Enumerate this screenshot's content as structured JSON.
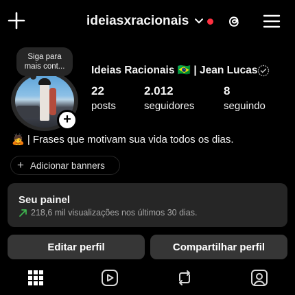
{
  "header": {
    "username": "ideiasxracionais",
    "create_icon": "plus-icon",
    "threads_icon": "threads-icon",
    "menu_icon": "menu-icon"
  },
  "note": {
    "text_line1": "Siga para",
    "text_line2": "mais cont..."
  },
  "profile": {
    "display_name": "Ideias Racionais 🇧🇷 | Jean Lucas",
    "stats": [
      {
        "value": "22",
        "label": "posts"
      },
      {
        "value": "2.012",
        "label": "seguidores"
      },
      {
        "value": "8",
        "label": "seguindo"
      }
    ],
    "bio": "🙇 | Frases que motivam sua vida todos os dias."
  },
  "banners": {
    "label": "Adicionar banners"
  },
  "panel": {
    "title": "Seu painel",
    "subtitle": "218,6 mil visualizações nos últimos 30 dias."
  },
  "actions": {
    "edit_label": "Editar perfil",
    "share_label": "Compartilhar perfil"
  },
  "tabs": [
    "grid-icon",
    "reels-icon",
    "reposts-icon",
    "tagged-icon"
  ],
  "colors": {
    "background": "#000000",
    "surface": "#262626",
    "button": "#363636",
    "notification": "#ff3040",
    "accent_green": "#3fb950"
  }
}
